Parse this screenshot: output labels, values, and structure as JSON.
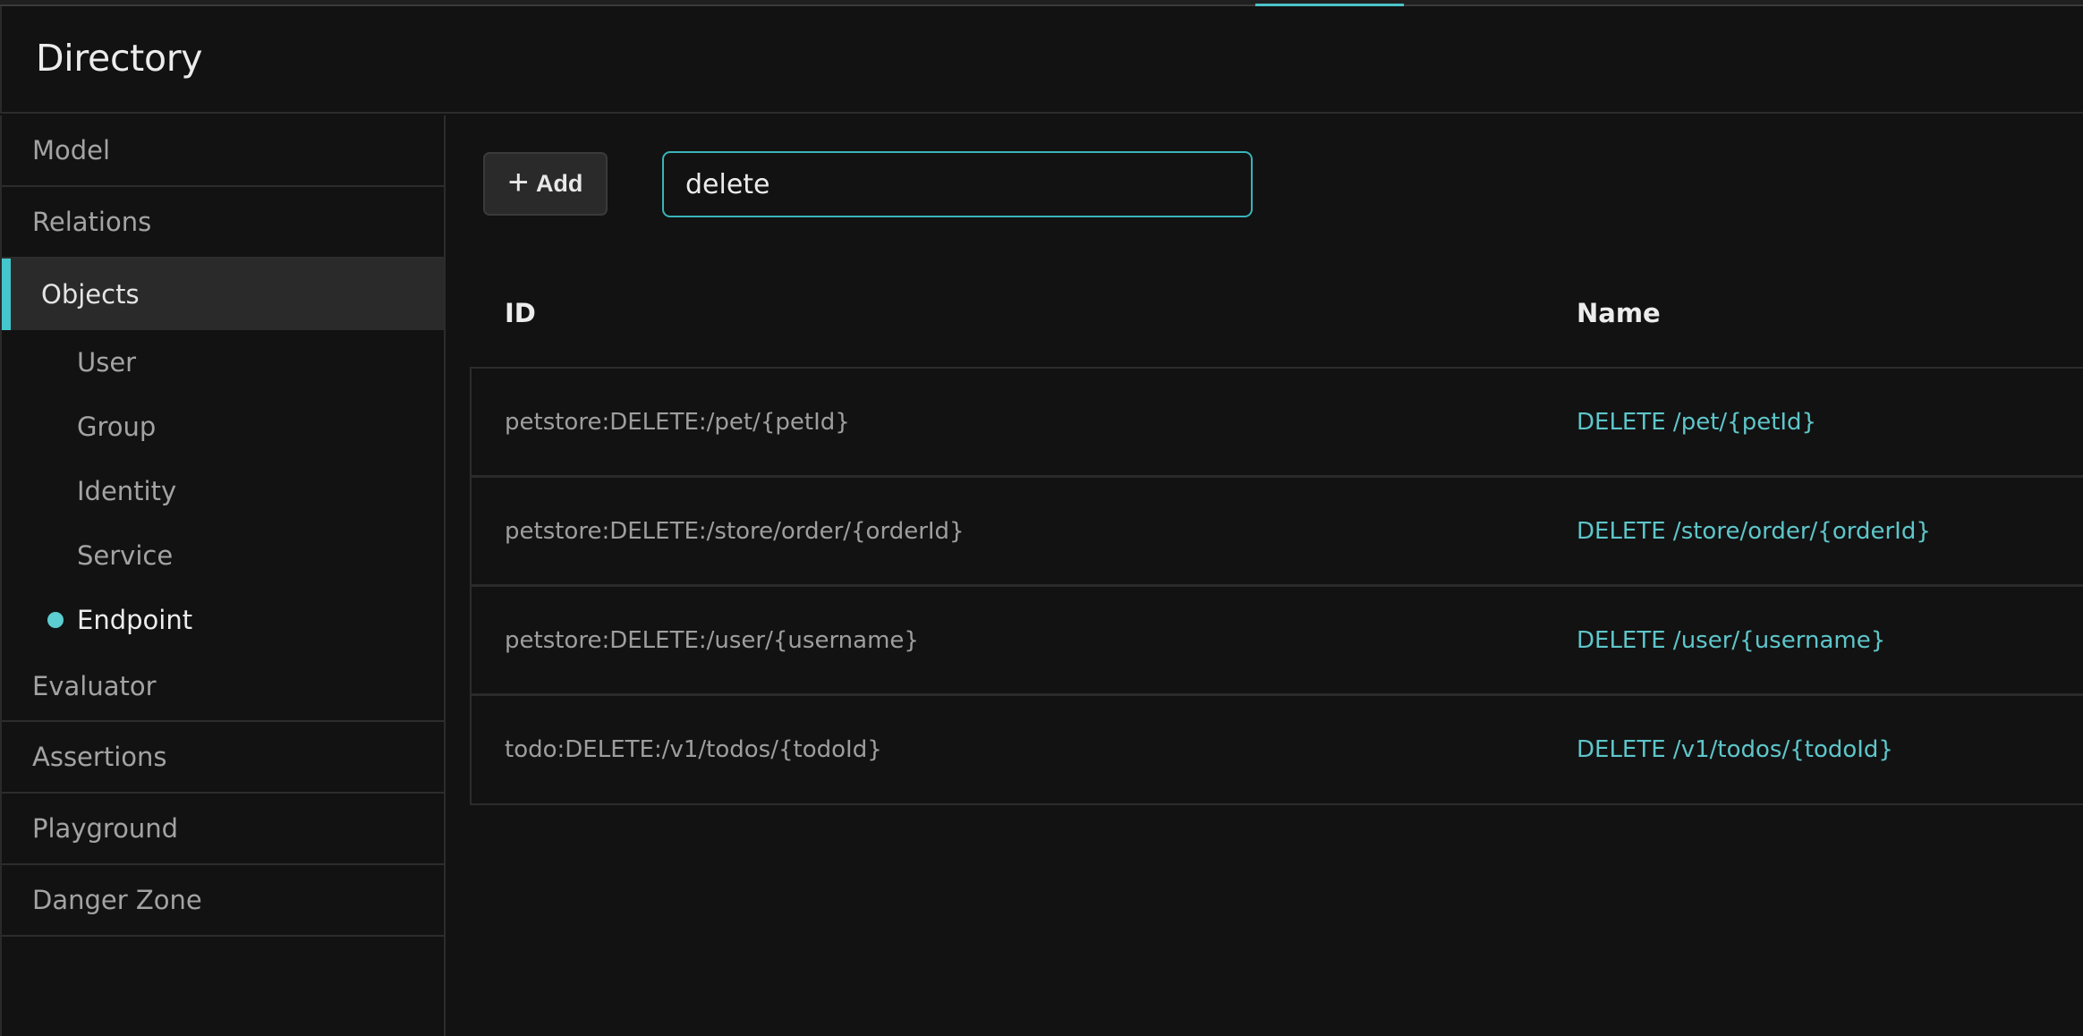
{
  "app": {
    "title": "Directory",
    "accent_color": "#44c7cc"
  },
  "sidebar": {
    "items": [
      {
        "label": "Model"
      },
      {
        "label": "Relations"
      },
      {
        "label": "Objects",
        "active": true
      }
    ],
    "sub_items": [
      {
        "label": "User"
      },
      {
        "label": "Group"
      },
      {
        "label": "Identity"
      },
      {
        "label": "Service"
      },
      {
        "label": "Endpoint",
        "active": true
      }
    ],
    "items_after": [
      {
        "label": "Evaluator"
      },
      {
        "label": "Assertions"
      },
      {
        "label": "Playground"
      },
      {
        "label": "Danger Zone"
      }
    ]
  },
  "toolbar": {
    "add_icon": "plus-icon",
    "add_label": "Add",
    "search_value": "delete"
  },
  "table": {
    "columns": [
      "ID",
      "Name"
    ],
    "rows": [
      {
        "id": "petstore:DELETE:/pet/{petId}",
        "name": "DELETE /pet/{petId}"
      },
      {
        "id": "petstore:DELETE:/store/order/{orderId}",
        "name": "DELETE /store/order/{orderId}"
      },
      {
        "id": "petstore:DELETE:/user/{username}",
        "name": "DELETE /user/{username}"
      },
      {
        "id": "todo:DELETE:/v1/todos/{todoId}",
        "name": "DELETE /v1/todos/{todoId}"
      }
    ]
  }
}
